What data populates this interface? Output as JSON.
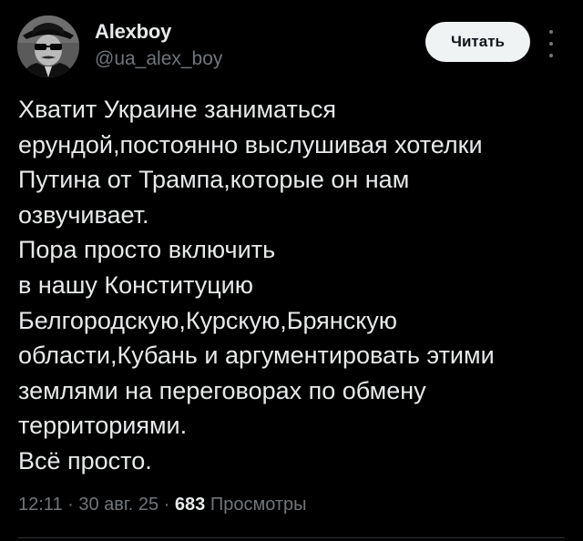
{
  "author": {
    "display_name": "Alexboy",
    "handle": "@ua_alex_boy"
  },
  "follow_button": {
    "label": "Читать"
  },
  "tweet": {
    "lines": [
      "Хватит Украине заниматься",
      "ерундой,постоянно выслушивая хотелки",
      "Путина от Трампа,которые он нам",
      "озвучивает.",
      "Пора просто включить",
      "в нашу Конституцию",
      "Белгородскую,Курскую,Брянскую",
      "области,Кубань и аргументировать этими",
      "землями на переговорах по обмену",
      "территориями.",
      "Всё просто."
    ]
  },
  "meta": {
    "time": "12:11",
    "separator": " · ",
    "date": "30 авг. 25",
    "views_count": "683",
    "views_label": "Просмотры"
  },
  "colors": {
    "background": "#000000",
    "text_primary": "#e7e9ea",
    "text_secondary": "#71767b",
    "button_bg": "#eff3f4",
    "button_text": "#0f1419",
    "divider": "#2f3336"
  },
  "icons": {
    "avatar": "profile-photo",
    "more": "more-vertical-icon"
  }
}
